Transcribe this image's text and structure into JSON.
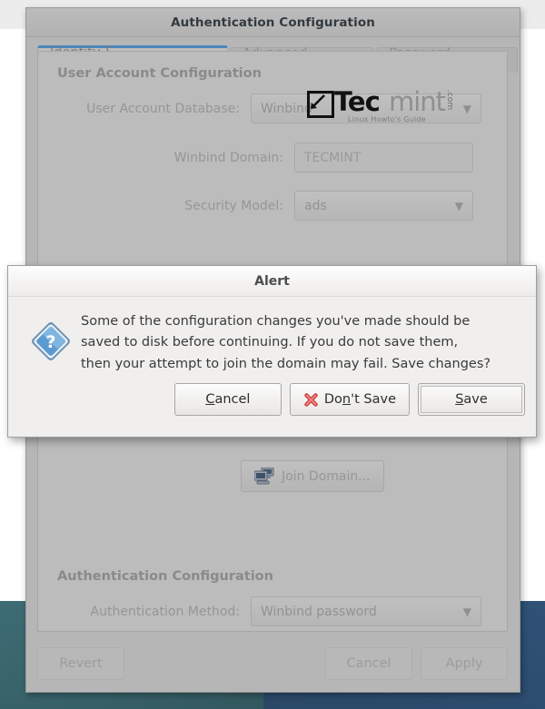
{
  "window": {
    "title": "Authentication Configuration",
    "tabs": [
      {
        "label": "Identity & Authentication",
        "active": true
      },
      {
        "label": "Advanced Options",
        "active": false
      },
      {
        "label": "Password Options",
        "active": false
      }
    ],
    "sections": {
      "user_account": {
        "heading": "User Account Configuration",
        "fields": [
          {
            "label": "User Account Database:",
            "value": "Winbind",
            "type": "combo"
          },
          {
            "label": "Winbind Domain:",
            "value": "TECMINT",
            "type": "entry"
          },
          {
            "label": "Security Model:",
            "value": "ads",
            "type": "combo"
          }
        ]
      },
      "join": {
        "button_label": "Join Domain...",
        "icon": "two-computers-icon"
      },
      "auth_config": {
        "heading": "Authentication Configuration",
        "fields": [
          {
            "label": "Authentication Method:",
            "value": "Winbind password",
            "type": "combo"
          }
        ]
      }
    },
    "action_buttons": [
      {
        "label": "Revert"
      },
      {
        "label": "Cancel"
      },
      {
        "label": "Apply"
      }
    ]
  },
  "logo": {
    "mark": "square-diagonal-arrow-icon",
    "text_bold": "Tec",
    "text_light": "mint",
    "suffix": ".com",
    "tagline": "Linux Howto's Guide"
  },
  "alert": {
    "title": "Alert",
    "icon": "question-diamond-icon",
    "message_lines": [
      "Some of the configuration changes you've made should be",
      "saved to disk before continuing.  If you do not save them,",
      "then your attempt to join the domain may fail.  Save changes?"
    ],
    "buttons": [
      {
        "name": "cancel",
        "pre": "",
        "mnemonic": "C",
        "post": "ancel",
        "icon": null,
        "focused": false
      },
      {
        "name": "dont-save",
        "pre": "Do",
        "mnemonic": "n",
        "post": "'t Save",
        "icon": "red-x-icon",
        "focused": false
      },
      {
        "name": "save",
        "pre": "",
        "mnemonic": "S",
        "post": "ave",
        "icon": null,
        "focused": true
      }
    ]
  },
  "colors": {
    "accent_tab": "#4a86bb",
    "window_bg": "#b6b6b6",
    "dialog_bg": "#f0efee",
    "desktop_teal": "#35626a",
    "desktop_blue": "#2c4f70",
    "icon_question_blue": "#3c7fc4",
    "icon_x_red": "#d04040"
  }
}
